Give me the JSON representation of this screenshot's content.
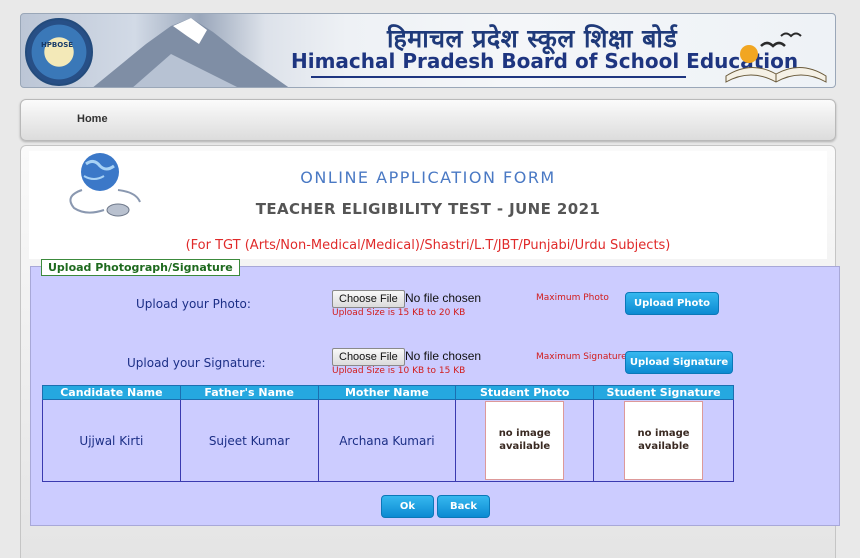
{
  "banner": {
    "title_hindi": "हिमाचल प्रदेश स्कूल शिक्षा बोर्ड",
    "title_english": "Himachal Pradesh Board of School Education"
  },
  "nav": {
    "home": "Home"
  },
  "form": {
    "title": "ONLINE APPLICATION FORM",
    "subtitle": "TEACHER ELIGIBILITY TEST - JUNE 2021",
    "note": "(For TGT (Arts/Non-Medical/Medical)/Shastri/L.T/JBT/Punjabi/Urdu Subjects)"
  },
  "upload": {
    "legend": "Upload Photograph/Signature",
    "photo": {
      "label": "Upload your Photo:",
      "choose_label": "Choose File",
      "file_status": "No file chosen",
      "size_hint": "Upload Size is 15 KB to 20 KB",
      "max_note": "Maximum Photo",
      "button": "Upload Photo"
    },
    "signature": {
      "label": "Upload your Signature:",
      "choose_label": "Choose File",
      "file_status": "No file chosen",
      "size_hint": "Upload Size is 10 KB to 15 KB",
      "max_note": "Maximum Signature",
      "button": "Upload Signature"
    }
  },
  "table": {
    "headers": [
      "Candidate Name",
      "Father's Name",
      "Mother Name",
      "Student Photo",
      "Student Signature"
    ],
    "row": {
      "candidate": "Ujjwal Kirti",
      "father": "Sujeet Kumar",
      "mother": "Archana Kumari",
      "photo_placeholder": "no image available",
      "signature_placeholder": "no image available"
    }
  },
  "actions": {
    "ok": "Ok",
    "back": "Back"
  }
}
